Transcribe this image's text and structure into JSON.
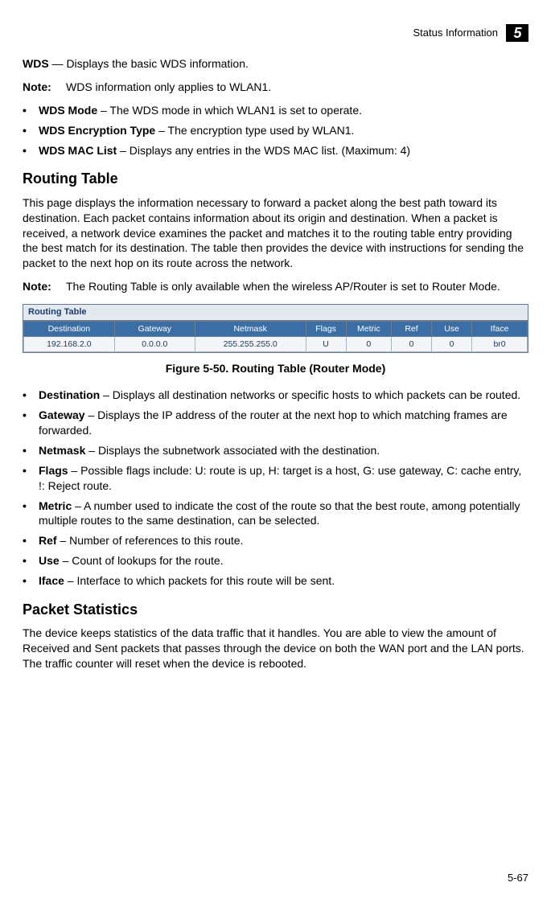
{
  "header": {
    "section": "Status Information",
    "chapter": "5"
  },
  "wds": {
    "title": "WDS",
    "title_rest": " — Displays the basic WDS information.",
    "note_label": "Note:",
    "note_text": "WDS information only applies to WLAN1.",
    "items": [
      {
        "bold": "WDS Mode",
        "rest": " – The WDS mode in which WLAN1 is set to operate."
      },
      {
        "bold": "WDS Encryption Type",
        "rest": " – The encryption type used by WLAN1."
      },
      {
        "bold": "WDS MAC List",
        "rest": " – Displays any entries in the WDS MAC list. (Maximum: 4)"
      }
    ]
  },
  "routing": {
    "heading": "Routing Table",
    "para": "This page displays the information necessary to forward a packet along the best path toward its destination. Each packet contains information about its origin and destination. When a packet is received, a network device examines the packet and matches it to the routing table entry providing the best match for its destination. The table then provides the device with instructions for sending the packet to the next hop on its route across the network.",
    "note_label": "Note:",
    "note_text": "The Routing Table is only available when the wireless AP/Router is set to Router Mode.",
    "table_title": "Routing Table",
    "columns": [
      "Destination",
      "Gateway",
      "Netmask",
      "Flags",
      "Metric",
      "Ref",
      "Use",
      "Iface"
    ],
    "row": [
      "192.168.2.0",
      "0.0.0.0",
      "255.255.255.0",
      "U",
      "0",
      "0",
      "0",
      "br0"
    ],
    "caption": "Figure 5-50.   Routing Table (Router Mode)",
    "items": [
      {
        "bullet": "•",
        "bold": "Destination",
        "rest": " – Displays all destination networks or specific hosts to which packets can be routed."
      },
      {
        "bullet": "•",
        "bold": "Gateway",
        "rest": " – Displays the IP address of the router at the next hop to which matching frames are forwarded."
      },
      {
        "bullet": "•",
        "bold": "Netmask",
        "rest": " – Displays the subnetwork associated with the destination."
      },
      {
        "bullet": "•",
        "bold": "Flags",
        "rest": " – Possible flags include: U: route is up, H: target is a host, G: use gateway, C: cache entry, !: Reject route."
      },
      {
        "bullet": "•",
        "bold": "Metric",
        "rest": " – A number used to indicate the cost of the route so that the best route, among potentially multiple routes to the same destination, can be selected."
      },
      {
        "bullet": "•",
        "bold": "Ref",
        "rest": " – Number of references to this route."
      },
      {
        "bullet": "•",
        "bold": "Use",
        "rest": " – Count of lookups for the route."
      },
      {
        "bullet": "•",
        "bold": "Iface",
        "rest": " – Interface to which packets for this route will be sent."
      }
    ]
  },
  "packet": {
    "heading": "Packet Statistics",
    "para": "The device keeps statistics of the data traffic that it handles. You are able to view the amount of Received and Sent packets that passes through the device on both the WAN port and the LAN ports. The traffic counter will reset when the device is rebooted."
  },
  "page_number": "5-67",
  "chart_data": {
    "type": "table",
    "title": "Routing Table",
    "columns": [
      "Destination",
      "Gateway",
      "Netmask",
      "Flags",
      "Metric",
      "Ref",
      "Use",
      "Iface"
    ],
    "rows": [
      [
        "192.168.2.0",
        "0.0.0.0",
        "255.255.255.0",
        "U",
        0,
        0,
        0,
        "br0"
      ]
    ]
  }
}
